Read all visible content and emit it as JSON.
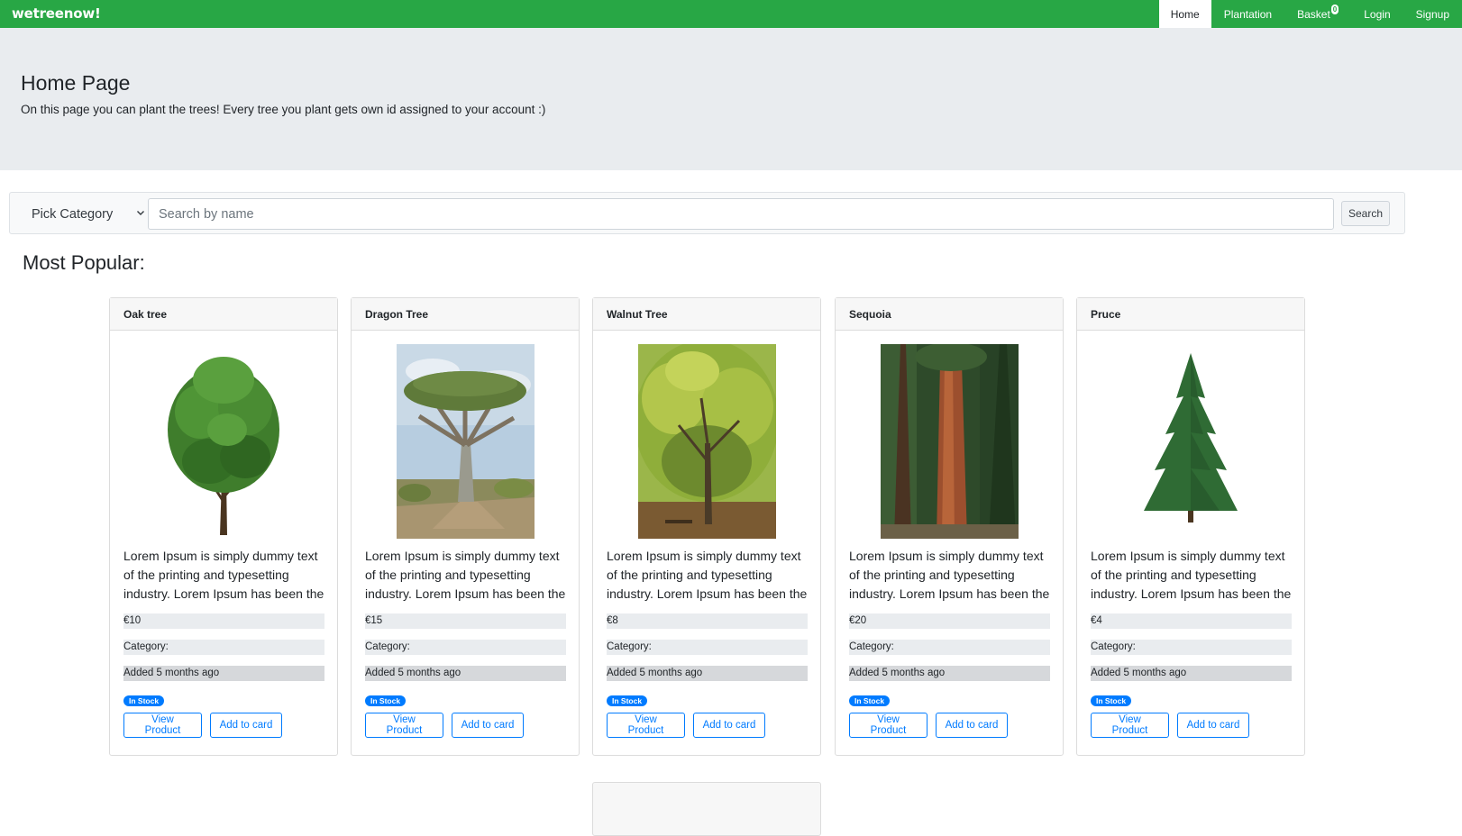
{
  "navbar": {
    "brand": "wetreenow!",
    "items": [
      {
        "label": "Home",
        "active": true
      },
      {
        "label": "Plantation"
      },
      {
        "label": "Basket",
        "badge": "0"
      },
      {
        "label": "Login"
      },
      {
        "label": "Signup"
      }
    ],
    "color": "#28a745"
  },
  "jumbotron": {
    "title": "Home Page",
    "subtitle": "On this page you can plant the trees! Every tree you plant gets own id assigned to your account :)"
  },
  "search": {
    "category_selected": "Pick Category",
    "placeholder": "Search by name",
    "button_label": "Search"
  },
  "section_title": "Most Popular:",
  "products": [
    {
      "name": "Oak tree",
      "image": "oak-tree-image",
      "description": "Lorem Ipsum is simply dummy text of the printing and typesetting industry. Lorem Ipsum has been the",
      "price": "€10",
      "category": "Category:",
      "added": "Added 5 months ago",
      "stock": "In Stock",
      "view_label": "View Product",
      "add_label": "Add to card"
    },
    {
      "name": "Dragon Tree",
      "image": "dragon-tree-image",
      "description": "Lorem Ipsum is simply dummy text of the printing and typesetting industry. Lorem Ipsum has been the",
      "price": "€15",
      "category": "Category:",
      "added": "Added 5 months ago",
      "stock": "In Stock",
      "view_label": "View Product",
      "add_label": "Add to card"
    },
    {
      "name": "Walnut Tree",
      "image": "walnut-tree-image",
      "description": "Lorem Ipsum is simply dummy text of the printing and typesetting industry. Lorem Ipsum has been the",
      "price": "€8",
      "category": "Category:",
      "added": "Added 5 months ago",
      "stock": "In Stock",
      "view_label": "View Product",
      "add_label": "Add to card"
    },
    {
      "name": "Sequoia",
      "image": "sequoia-image",
      "description": "Lorem Ipsum is simply dummy text of the printing and typesetting industry. Lorem Ipsum has been the",
      "price": "€20",
      "category": "Category:",
      "added": "Added 5 months ago",
      "stock": "In Stock",
      "view_label": "View Product",
      "add_label": "Add to card"
    },
    {
      "name": "Pruce",
      "image": "spruce-image",
      "description": "Lorem Ipsum is simply dummy text of the printing and typesetting industry. Lorem Ipsum has been the",
      "price": "€4",
      "category": "Category:",
      "added": "Added 5 months ago",
      "stock": "In Stock",
      "view_label": "View Product",
      "add_label": "Add to card"
    }
  ],
  "colors": {
    "primary": "#007bff",
    "navbar": "#28a745",
    "jumbotron": "#e9ecef"
  }
}
